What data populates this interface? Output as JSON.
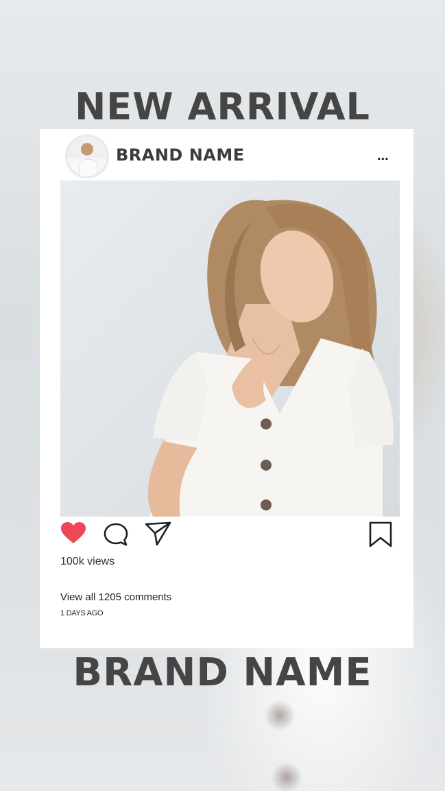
{
  "headline_top": "NEW ARRIVAL",
  "headline_bottom": "BRAND NAME",
  "post": {
    "brand_name": "BRAND NAME",
    "more_label": "...",
    "views": "100k views",
    "comments_link": "View all 1205 comments",
    "timestamp": "1 DAYS AGO",
    "liked": true
  },
  "icons": {
    "like": "heart-icon",
    "comment": "comment-bubble-icon",
    "share": "send-paper-plane-icon",
    "save": "bookmark-icon"
  },
  "colors": {
    "heart": "#ec4857",
    "headline": "#454545",
    "card": "#ffffff"
  }
}
